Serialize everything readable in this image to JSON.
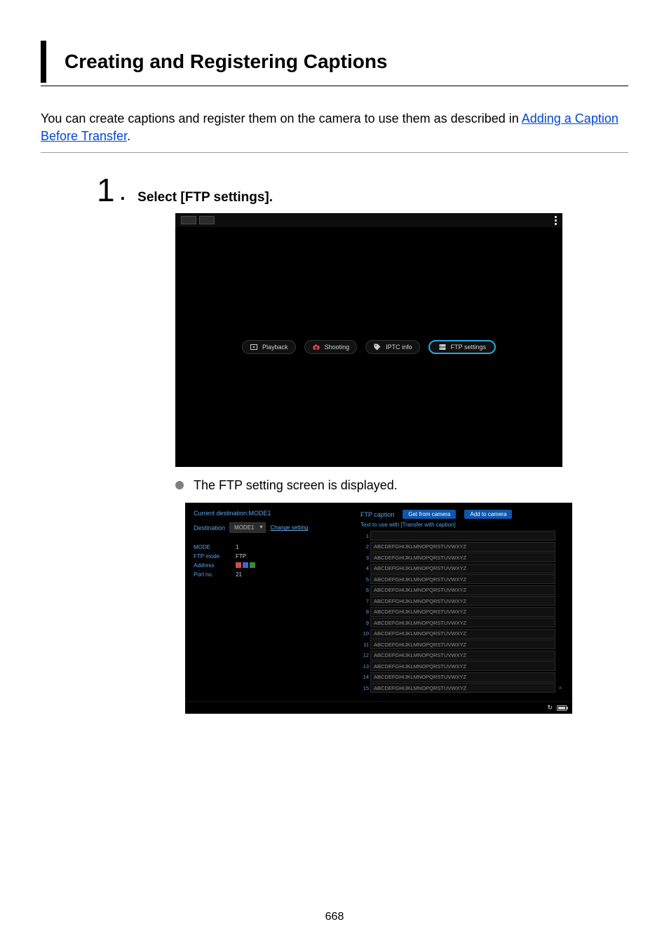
{
  "page": {
    "title": "Creating and Registering Captions",
    "intro_before": "You can create captions and register them on the camera to use them as described in ",
    "intro_link": "Adding a Caption Before Transfer",
    "intro_after": ".",
    "page_number": "668"
  },
  "step": {
    "number": "1",
    "title": "Select [FTP settings].",
    "sub_note": "The FTP setting screen is displayed."
  },
  "shot1": {
    "pills": {
      "playback": "Playback",
      "shooting": "Shooting",
      "iptc": "IPTC info",
      "ftp": "FTP settings"
    }
  },
  "shot2": {
    "left": {
      "current_dest": "Current destination:MODE1",
      "dest_label": "Destination",
      "dest_value": "MODE1",
      "change_link": "Change setting",
      "rows": {
        "mode_key": "MODE",
        "mode_val": "1",
        "ftpmode_key": "FTP mode",
        "ftpmode_val": "FTP",
        "address_key": "Address",
        "port_key": "Port no.",
        "port_val": "21"
      }
    },
    "right": {
      "label": "FTP caption",
      "btn_get": "Get from camera",
      "btn_add": "Add to camera",
      "desc": "Text to use with [Transfer with caption]",
      "captions": [
        {
          "n": "1",
          "v": ""
        },
        {
          "n": "2",
          "v": "ABCDEFGHIJKLMNOPQRSTUVWXYZ"
        },
        {
          "n": "3",
          "v": "ABCDEFGHIJKLMNOPQRSTUVWXYZ"
        },
        {
          "n": "4",
          "v": "ABCDEFGHIJKLMNOPQRSTUVWXYZ"
        },
        {
          "n": "5",
          "v": "ABCDEFGHIJKLMNOPQRSTUVWXYZ"
        },
        {
          "n": "6",
          "v": "ABCDEFGHIJKLMNOPQRSTUVWXYZ"
        },
        {
          "n": "7",
          "v": "ABCDEFGHIJKLMNOPQRSTUVWXYZ"
        },
        {
          "n": "8",
          "v": "ABCDEFGHIJKLMNOPQRSTUVWXYZ"
        },
        {
          "n": "9",
          "v": "ABCDEFGHIJKLMNOPQRSTUVWXYZ"
        },
        {
          "n": "10",
          "v": "ABCDEFGHIJKLMNOPQRSTUVWXYZ"
        },
        {
          "n": "11",
          "v": "ABCDEFGHIJKLMNOPQRSTUVWXYZ"
        },
        {
          "n": "12",
          "v": "ABCDEFGHIJKLMNOPQRSTUVWXYZ"
        },
        {
          "n": "13",
          "v": "ABCDEFGHIJKLMNOPQRSTUVWXYZ"
        },
        {
          "n": "14",
          "v": "ABCDEFGHIJKLMNOPQRSTUVWXYZ"
        },
        {
          "n": "15",
          "v": "ABCDEFGHIJKLMNOPQRSTUVWXYZ"
        }
      ]
    }
  }
}
